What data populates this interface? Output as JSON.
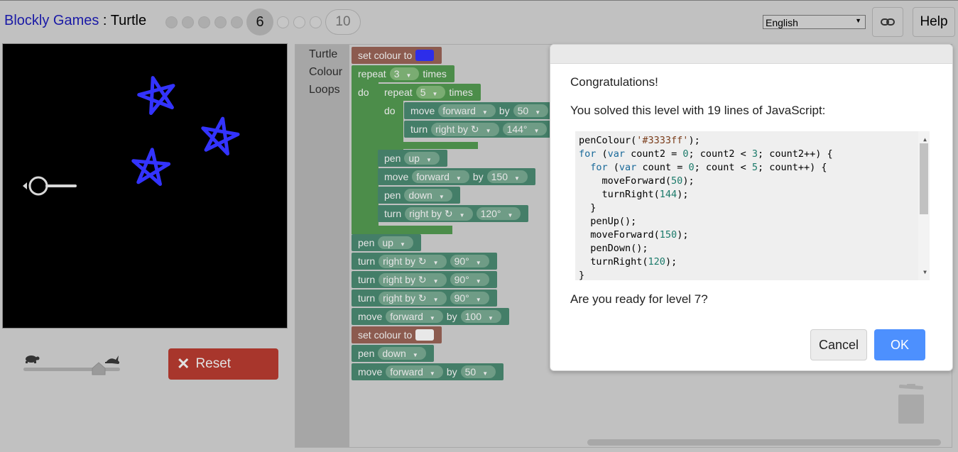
{
  "header": {
    "app_name": "Blockly Games",
    "separator": " : ",
    "game_name": "Turtle",
    "current_level": "6",
    "last_level": "10",
    "language": "English",
    "help_label": "Help"
  },
  "toolbox": {
    "categories": [
      "Turtle",
      "Colour",
      "Loops"
    ]
  },
  "controls": {
    "reset_label": "Reset"
  },
  "blocks": {
    "set_colour": "set colour to",
    "repeat": "repeat",
    "times": "times",
    "do": "do",
    "move": "move",
    "forward": "forward",
    "by": "by",
    "turn": "turn",
    "right_by": "right by ↻",
    "pen": "pen",
    "up": "up",
    "down": "down",
    "outer_repeat_count": "3",
    "inner_repeat_count": "5",
    "inner_move": "50",
    "inner_turn": "144°",
    "move_150": "150",
    "turn_120": "120°",
    "turn_90": "90°",
    "move_100": "100",
    "move_50": "50",
    "colour_blue": "#3333ff",
    "colour_white": "#ffffff"
  },
  "dialog": {
    "congrats": "Congratulations!",
    "solved": "You solved this level with 19 lines of JavaScript:",
    "code_lines": [
      "penColour('#3333ff');",
      "for (var count2 = 0; count2 < 3; count2++) {",
      "  for (var count = 0; count < 5; count++) {",
      "    moveForward(50);",
      "    turnRight(144);",
      "  }",
      "  penUp();",
      "  moveForward(150);",
      "  penDown();",
      "  turnRight(120);",
      "}"
    ],
    "question": "Are you ready for level 7?",
    "cancel_label": "Cancel",
    "ok_label": "OK"
  },
  "colors": {
    "accent_ok": "#4d90fe",
    "reset_red": "#a8362c",
    "star_blue": "#3333ff"
  },
  "icons": [
    "link-icon",
    "turtle-icon",
    "rabbit-icon",
    "close-x-icon",
    "trash-icon"
  ]
}
